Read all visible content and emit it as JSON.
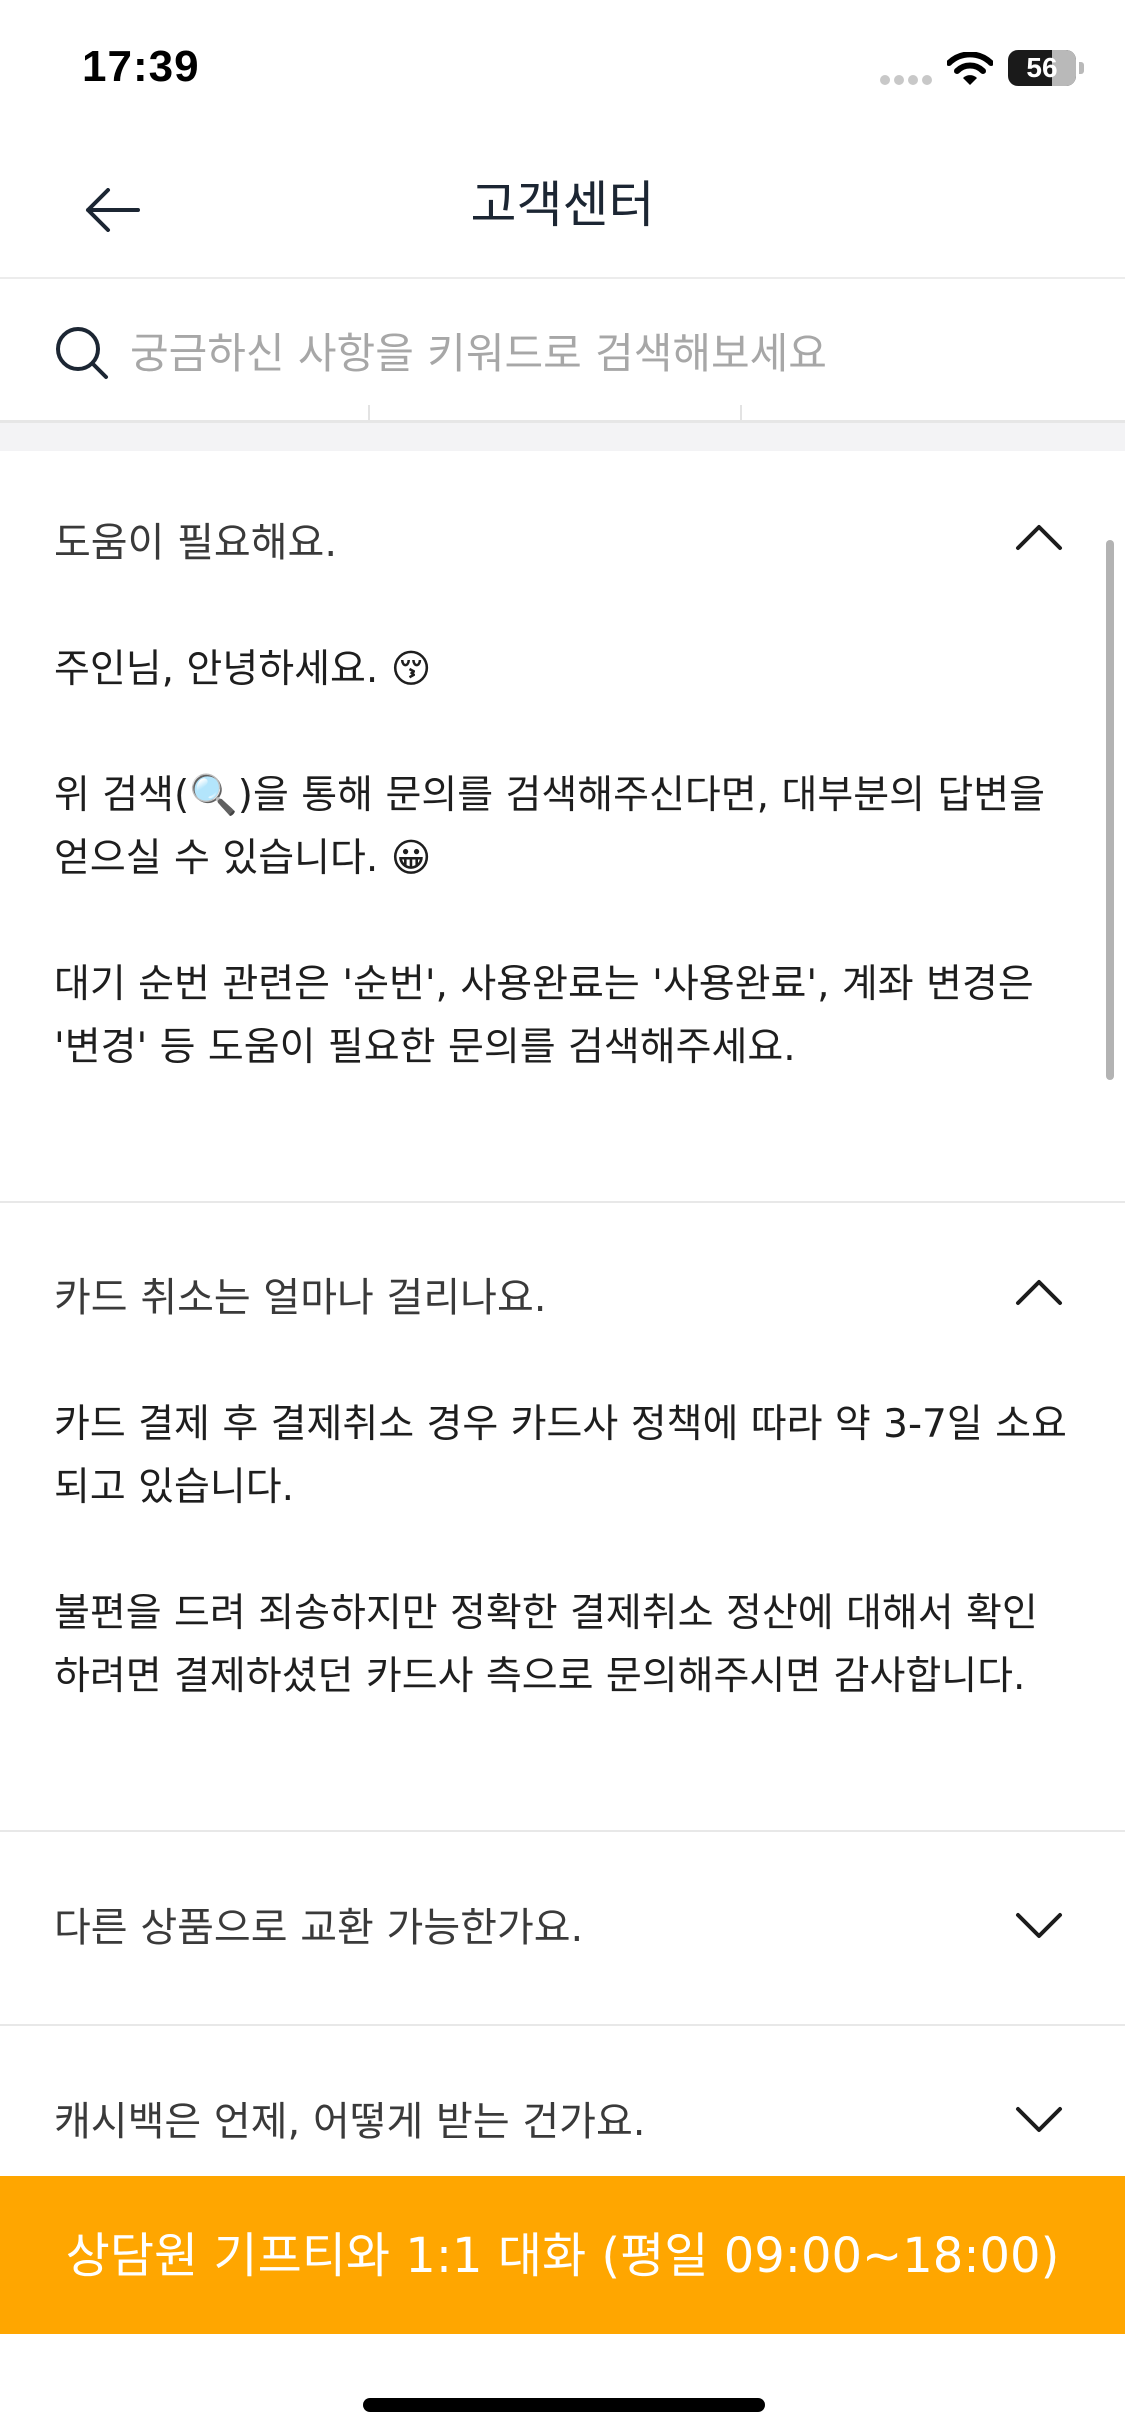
{
  "status_bar": {
    "time": "17:39",
    "battery": "56",
    "icons": [
      "signal-icon",
      "wifi-icon",
      "battery-icon"
    ]
  },
  "header": {
    "title": "고객센터",
    "back_icon": "arrow-left-icon"
  },
  "search": {
    "placeholder": "궁금하신 사항을 키워드로 검색해보세요",
    "icon": "search-icon"
  },
  "faq": [
    {
      "question": "도움이 필요해요.",
      "expanded": true,
      "answer": [
        "주인님, 안녕하세요. 😚",
        "위 검색(🔍)을 통해 문의를 검색해주신다면, 대부분의 답변을 얻으실 수 있습니다. 😀",
        "대기 순번 관련은 '순번', 사용완료는 '사용완료', 계좌 변경은 '변경' 등 도움이 필요한 문의를 검색해주세요."
      ]
    },
    {
      "question": "카드 취소는 얼마나 걸리나요.",
      "expanded": true,
      "answer": [
        "카드 결제 후 결제취소 경우 카드사 정책에 따라 약 3-7일 소요되고 있습니다.",
        "불편을 드려 죄송하지만 정확한 결제취소 정산에 대해서 확인하려면 결제하셨던 카드사 측으로 문의해주시면 감사합니다."
      ]
    },
    {
      "question": "다른 상품으로 교환 가능한가요.",
      "expanded": false
    },
    {
      "question": "캐시백은 언제, 어떻게 받는 건가요.",
      "expanded": false
    }
  ],
  "cta": {
    "label": "상담원 기프티와 1:1 대화 (평일 09:00~18:00)"
  },
  "colors": {
    "accent": "#ffa600",
    "title": "#1c2633",
    "divider": "#e8e8e8"
  }
}
